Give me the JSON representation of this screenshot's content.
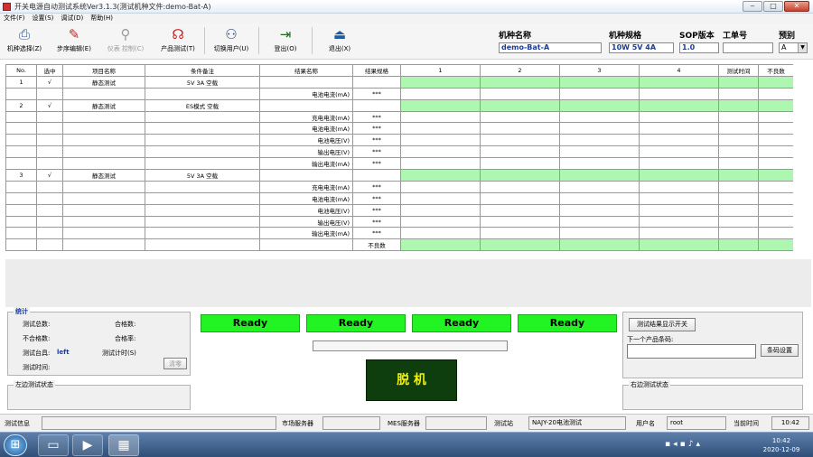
{
  "window": {
    "title": "开关电源自动测试系统Ver3.1.3(测试机种文件:demo-Bat-A)"
  },
  "menu": [
    "文件(F)",
    "设置(S)",
    "调试(D)",
    "帮助(H)"
  ],
  "toolbar": {
    "buttons": [
      {
        "label": "机种选择(Z)",
        "icon": "model-select-icon",
        "enabled": true
      },
      {
        "label": "步序编辑(E)",
        "icon": "step-edit-icon",
        "enabled": true
      },
      {
        "label": "仪表 控制(C)",
        "icon": "instrument-icon",
        "enabled": false
      },
      {
        "label": "产品测试(T)",
        "icon": "product-test-icon",
        "enabled": true
      },
      {
        "label": "切换用户(U)",
        "icon": "switch-user-icon",
        "enabled": true
      },
      {
        "label": "登出(O)",
        "icon": "logout-icon",
        "enabled": true
      },
      {
        "label": "退出(X)",
        "icon": "exit-icon",
        "enabled": true
      }
    ]
  },
  "header": {
    "model_name_label": "机种名称",
    "model_name": "demo-Bat-A",
    "model_spec_label": "机种规格",
    "model_spec": "10W 5V 4A",
    "sop_label": "SOP版本",
    "sop": "1.0",
    "work_order_label": "工单号",
    "work_order": "",
    "side_label": "预别",
    "side": "A"
  },
  "grid": {
    "columns": [
      "No.",
      "选中",
      "项目名称",
      "条件备注",
      "结果名称",
      "结果规格",
      "1",
      "2",
      "3",
      "4",
      "测试时间",
      "不良数"
    ],
    "rows": [
      {
        "no": "1",
        "sel": "√",
        "item": "静态测试",
        "cond": "5V 3A 空载",
        "result": "",
        "spec": "",
        "green": true
      },
      {
        "no": "",
        "sel": "",
        "item": "",
        "cond": "",
        "result": "电池电流(mA)",
        "spec": "***",
        "green": false
      },
      {
        "no": "2",
        "sel": "√",
        "item": "静态测试",
        "cond": "ES模式 空载",
        "result": "",
        "spec": "",
        "green": true
      },
      {
        "no": "",
        "sel": "",
        "item": "",
        "cond": "",
        "result": "充电电流(mA)",
        "spec": "***",
        "green": false
      },
      {
        "no": "",
        "sel": "",
        "item": "",
        "cond": "",
        "result": "电池电流(mA)",
        "spec": "***",
        "green": false
      },
      {
        "no": "",
        "sel": "",
        "item": "",
        "cond": "",
        "result": "电池电压(V)",
        "spec": "***",
        "green": false
      },
      {
        "no": "",
        "sel": "",
        "item": "",
        "cond": "",
        "result": "输出电压(V)",
        "spec": "***",
        "green": false
      },
      {
        "no": "",
        "sel": "",
        "item": "",
        "cond": "",
        "result": "输出电流(mA)",
        "spec": "***",
        "green": false
      },
      {
        "no": "3",
        "sel": "√",
        "item": "静态测试",
        "cond": "5V 3A 空载",
        "result": "",
        "spec": "",
        "green": true
      },
      {
        "no": "",
        "sel": "",
        "item": "",
        "cond": "",
        "result": "充电电流(mA)",
        "spec": "***",
        "green": false
      },
      {
        "no": "",
        "sel": "",
        "item": "",
        "cond": "",
        "result": "电池电流(mA)",
        "spec": "***",
        "green": false
      },
      {
        "no": "",
        "sel": "",
        "item": "",
        "cond": "",
        "result": "电池电压(V)",
        "spec": "***",
        "green": false
      },
      {
        "no": "",
        "sel": "",
        "item": "",
        "cond": "",
        "result": "输出电压(V)",
        "spec": "***",
        "green": false
      },
      {
        "no": "",
        "sel": "",
        "item": "",
        "cond": "",
        "result": "输出电流(mA)",
        "spec": "***",
        "green": false
      },
      {
        "no": "",
        "sel": "",
        "item": "",
        "cond": "",
        "result": "",
        "spec": "不良数",
        "green": true
      }
    ]
  },
  "stats": {
    "caption": "统计",
    "total_label": "测试总数:",
    "pass_label": "合格数:",
    "fail_label": "不合格数:",
    "rate_label": "合格率:",
    "station_label": "测试台具:",
    "station_value": "left",
    "timer_label": "测试计时(S)",
    "time_label": "测试时间:",
    "clear_label": "清零"
  },
  "ready": [
    "Ready",
    "Ready",
    "Ready",
    "Ready"
  ],
  "offline_label": "脱 机",
  "right_panel": {
    "toggle_label": "测试结果显示开关",
    "next_barcode_label": "下一个产品条码:",
    "next_barcode_value": "",
    "save_label": "条码设置"
  },
  "left_status_caption": "左边测试状态",
  "right_status_caption": "右边测试状态",
  "statusbar": {
    "info_label": "测试信息",
    "info_value": "",
    "market_label": "市场服务器",
    "market_value": "",
    "mes_label": "MES服务器",
    "mes_value": "",
    "station_label": "测试站",
    "station_value": "NAJY-20电池测试",
    "user_label": "用户名",
    "user_value": "root",
    "time_label": "当前时间",
    "time_value": "10:42"
  },
  "taskbar": {
    "time": "10:42",
    "date": "2020-12-09"
  },
  "colors": {
    "ready": "#22f322",
    "grid_green": "#adf7b1",
    "offline_bg": "#0e3d0e",
    "offline_text": "#f5f000",
    "caption": "#1a3c9c"
  }
}
